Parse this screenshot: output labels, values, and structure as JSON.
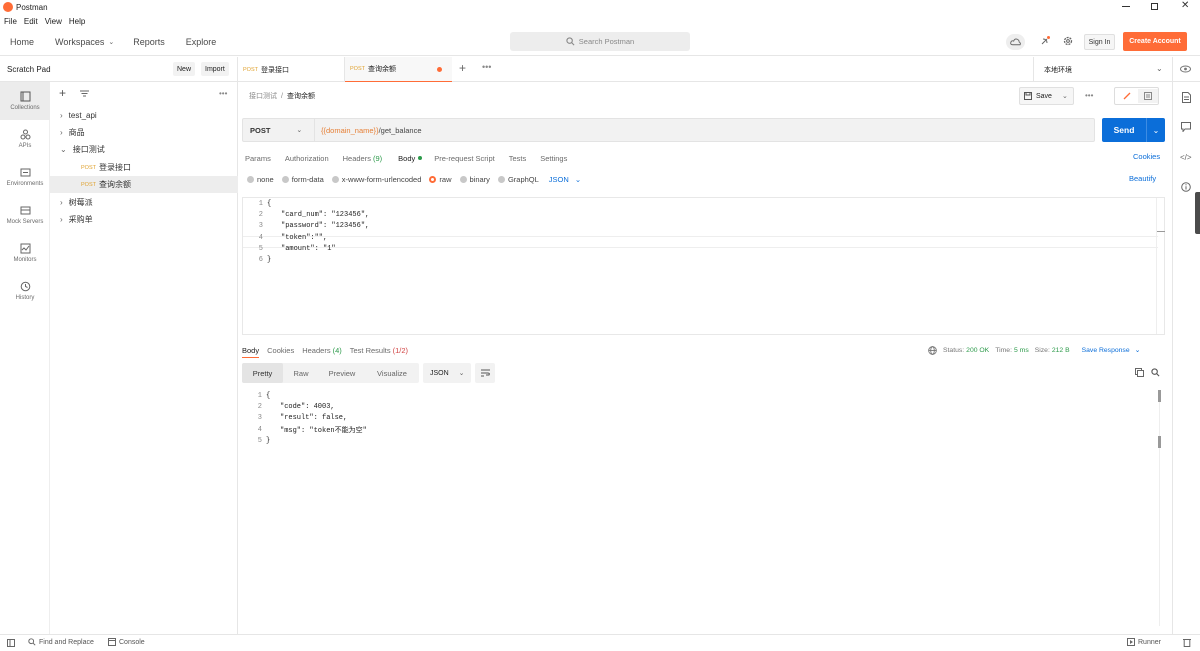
{
  "app": {
    "title": "Postman"
  },
  "menu": [
    "File",
    "Edit",
    "View",
    "Help"
  ],
  "header": {
    "nav": [
      "Home",
      "Workspaces",
      "Reports",
      "Explore"
    ],
    "search_placeholder": "Search Postman",
    "sign_in": "Sign In",
    "create_account": "Create Account",
    "brand_color": "#ff6c37"
  },
  "scratch": {
    "title": "Scratch Pad",
    "new": "New",
    "import": "Import"
  },
  "tabs": [
    {
      "method": "POST",
      "name": "登录接口"
    },
    {
      "method": "POST",
      "name": "查询余额"
    }
  ],
  "environment": "本地环境",
  "leftnav": [
    "Collections",
    "APIs",
    "Environments",
    "Mock Servers",
    "Monitors",
    "History"
  ],
  "tree": {
    "items": [
      "test_api",
      "商品",
      "接口测试",
      "树莓派",
      "采购单"
    ],
    "requests": [
      {
        "method": "POST",
        "name": "登录接口"
      },
      {
        "method": "POST",
        "name": "查询余额"
      }
    ]
  },
  "request": {
    "breadcrumb_parent": "接口测试",
    "breadcrumb_current": "查询余额",
    "save": "Save",
    "method": "POST",
    "url_var": "{{domain_name}}",
    "url_path": "/get_balance",
    "send": "Send",
    "tabs": [
      "Params",
      "Authorization",
      "Headers",
      "(9)",
      "Body",
      "Pre-request Script",
      "Tests",
      "Settings"
    ],
    "cookies": "Cookies",
    "body_types": [
      "none",
      "form-data",
      "x-www-form-urlencoded",
      "raw",
      "binary",
      "GraphQL"
    ],
    "body_format": "JSON",
    "beautify": "Beautify",
    "body_lines": [
      "{",
      "\"card_num\": \"123456\",",
      "\"password\": \"123456\",",
      "\"token\":\"\",",
      "\"amount\": \"1\"",
      "}"
    ]
  },
  "response": {
    "tabs": [
      "Body",
      "Cookies",
      "Headers",
      "(4)",
      "Test Results",
      "(1/2)"
    ],
    "status_label": "Status:",
    "status": "200 OK",
    "time_label": "Time:",
    "time": "5 ms",
    "size_label": "Size:",
    "size": "212 B",
    "save_response": "Save Response",
    "views": [
      "Pretty",
      "Raw",
      "Preview",
      "Visualize"
    ],
    "format": "JSON",
    "body_lines": [
      "{",
      "\"code\": 4003,",
      "\"result\": false,",
      "\"msg\": \"token不能为空\"",
      "}"
    ]
  },
  "statusbar": {
    "find": "Find and Replace",
    "console": "Console",
    "runner": "Runner"
  }
}
